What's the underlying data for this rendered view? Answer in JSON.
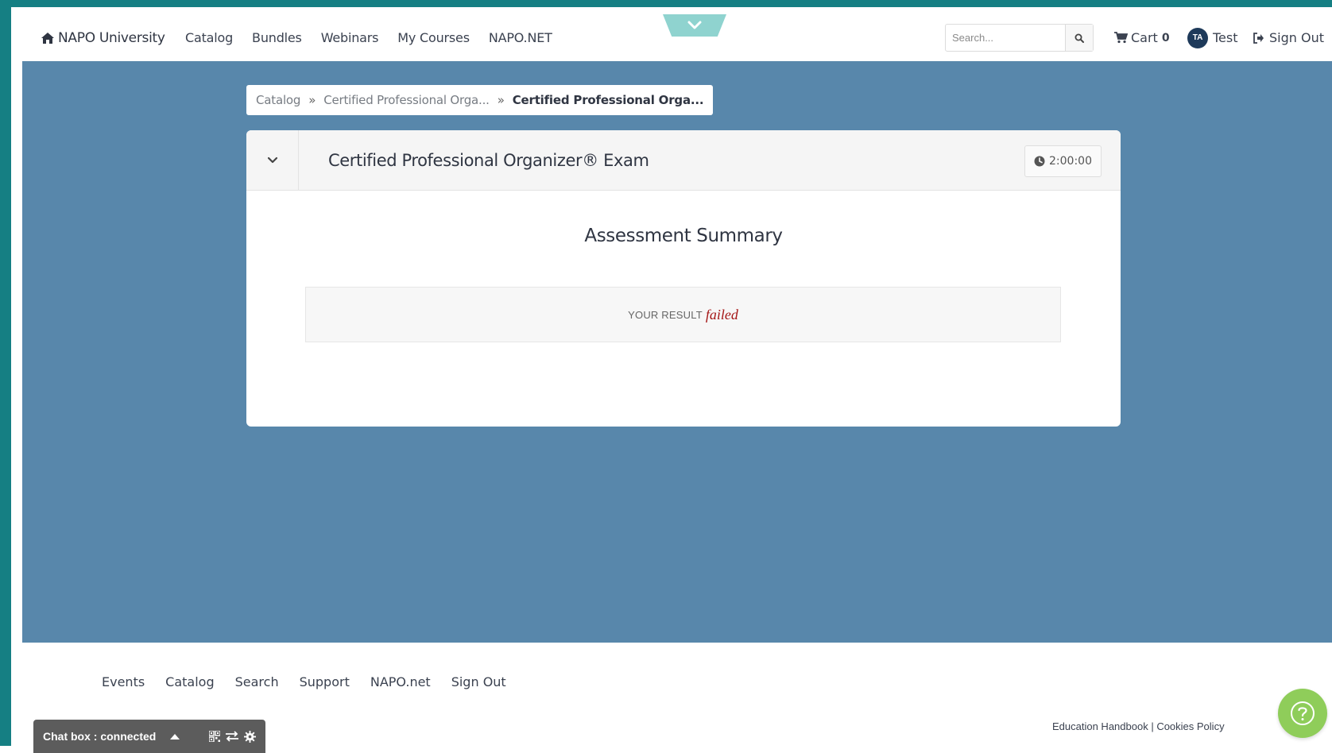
{
  "nav": {
    "brand": "NAPO University",
    "links": [
      "Catalog",
      "Bundles",
      "Webinars",
      "My Courses",
      "NAPO.NET"
    ],
    "search_placeholder": "Search...",
    "cart_label": "Cart",
    "cart_count": "0",
    "user_initials": "TA",
    "user_name": "Test",
    "signout_label": "Sign Out"
  },
  "breadcrumb": [
    "Catalog",
    "Certified Professional Orga...",
    "Certified Professional Orga..."
  ],
  "exam": {
    "title": "Certified Professional Organizer® Exam",
    "timer": "2:00:00",
    "summary_title": "Assessment Summary",
    "result_label": "YOUR RESULT",
    "result_value": "failed"
  },
  "footer": {
    "links": [
      "Events",
      "Catalog",
      "Search",
      "Support",
      "NAPO.net",
      "Sign Out"
    ],
    "handbook": "Education Handbook",
    "divider": " | ",
    "cookies": "Cookies Policy"
  },
  "chat": {
    "label": "Chat box : connected"
  },
  "colors": {
    "frame": "#157f83",
    "main_bg": "#5887ab",
    "result_failed": "#a51818",
    "help_button": "#8fcd5a",
    "avatar": "#1e3a5a"
  }
}
